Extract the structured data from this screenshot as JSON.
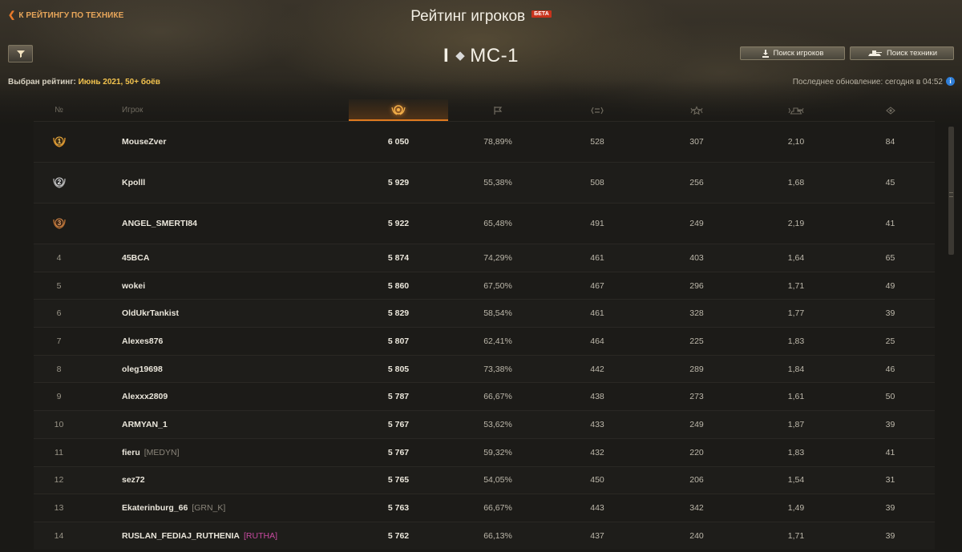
{
  "header": {
    "back_label": "К РЕЙТИНГУ ПО ТЕХНИКЕ",
    "title": "Рейтинг игроков",
    "beta": "БЕТА",
    "tank_tier": "I",
    "tank_name": "МС-1",
    "search_players": "Поиск игроков",
    "search_vehicles": "Поиск техники",
    "selected_label": "Выбран рейтинг:",
    "selected_value": "Июнь 2021, 50+ боёв",
    "update_text": "Последнее обновление: сегодня в 04:52",
    "info_glyph": "i"
  },
  "table": {
    "col_rank": "№",
    "col_player": "Игрок",
    "rows": [
      {
        "rank": "1",
        "name": "MouseZver",
        "clan": "",
        "score": "6 050",
        "winrate": "78,89%",
        "dmg": "528",
        "xp": "307",
        "kills": "2,10",
        "spot": "84"
      },
      {
        "rank": "2",
        "name": "Kpolll",
        "clan": "",
        "score": "5 929",
        "winrate": "55,38%",
        "dmg": "508",
        "xp": "256",
        "kills": "1,68",
        "spot": "45"
      },
      {
        "rank": "3",
        "name": "ANGEL_SMERTI84",
        "clan": "",
        "score": "5 922",
        "winrate": "65,48%",
        "dmg": "491",
        "xp": "249",
        "kills": "2,19",
        "spot": "41"
      },
      {
        "rank": "4",
        "name": "45BCA",
        "clan": "",
        "score": "5 874",
        "winrate": "74,29%",
        "dmg": "461",
        "xp": "403",
        "kills": "1,64",
        "spot": "65"
      },
      {
        "rank": "5",
        "name": "wokei",
        "clan": "",
        "score": "5 860",
        "winrate": "67,50%",
        "dmg": "467",
        "xp": "296",
        "kills": "1,71",
        "spot": "49"
      },
      {
        "rank": "6",
        "name": "OldUkrTankist",
        "clan": "",
        "score": "5 829",
        "winrate": "58,54%",
        "dmg": "461",
        "xp": "328",
        "kills": "1,77",
        "spot": "39"
      },
      {
        "rank": "7",
        "name": "Alexes876",
        "clan": "",
        "score": "5 807",
        "winrate": "62,41%",
        "dmg": "464",
        "xp": "225",
        "kills": "1,83",
        "spot": "25"
      },
      {
        "rank": "8",
        "name": "oleg19698",
        "clan": "",
        "score": "5 805",
        "winrate": "73,38%",
        "dmg": "442",
        "xp": "289",
        "kills": "1,84",
        "spot": "46"
      },
      {
        "rank": "9",
        "name": "Alexxx2809",
        "clan": "",
        "score": "5 787",
        "winrate": "66,67%",
        "dmg": "438",
        "xp": "273",
        "kills": "1,61",
        "spot": "50"
      },
      {
        "rank": "10",
        "name": "ARMYAN_1",
        "clan": "",
        "score": "5 767",
        "winrate": "53,62%",
        "dmg": "433",
        "xp": "249",
        "kills": "1,87",
        "spot": "39"
      },
      {
        "rank": "11",
        "name": "fieru",
        "clan": "[MEDYN]",
        "score": "5 767",
        "winrate": "59,32%",
        "dmg": "432",
        "xp": "220",
        "kills": "1,83",
        "spot": "41"
      },
      {
        "rank": "12",
        "name": "sez72",
        "clan": "",
        "score": "5 765",
        "winrate": "54,05%",
        "dmg": "450",
        "xp": "206",
        "kills": "1,54",
        "spot": "31"
      },
      {
        "rank": "13",
        "name": "Ekaterinburg_66",
        "clan": "[GRN_K]",
        "score": "5 763",
        "winrate": "66,67%",
        "dmg": "443",
        "xp": "342",
        "kills": "1,49",
        "spot": "39"
      },
      {
        "rank": "14",
        "name": "RUSLAN_FEDIAJ_RUTHENIA",
        "clan": "[RUTHA]",
        "score": "5 762",
        "winrate": "66,13%",
        "dmg": "437",
        "xp": "240",
        "kills": "1,71",
        "spot": "39"
      }
    ]
  },
  "colors": {
    "accent": "#e07a1f",
    "gold": "#f3c34e",
    "clan_pink": "#c84aa0"
  },
  "icons": {
    "score_col": "rating-medal-icon",
    "winrate_col": "flag-icon",
    "dmg_col": "damage-icon",
    "xp_col": "star-icon",
    "kills_col": "tank-kills-icon",
    "spot_col": "eye-icon"
  }
}
